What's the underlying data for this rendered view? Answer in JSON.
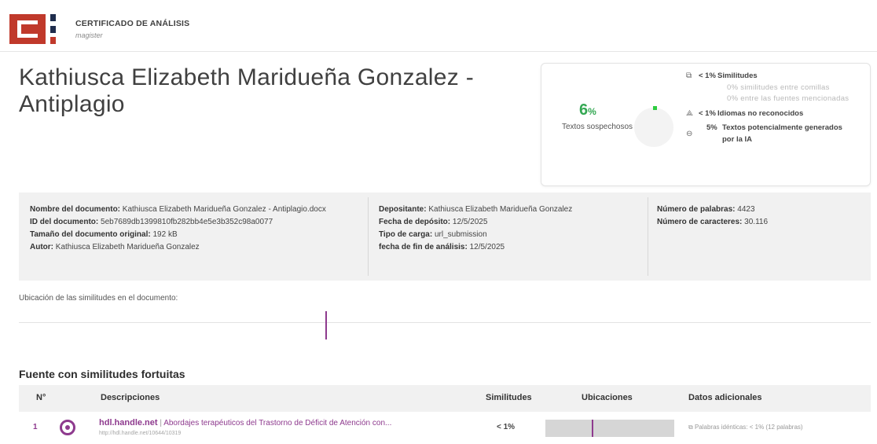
{
  "header": {
    "title": "CERTIFICADO DE ANÁLISIS",
    "subtitle": "magister"
  },
  "document": {
    "title": "Kathiusca Elizabeth Maridueña Gonzalez -Antiplagio"
  },
  "score": {
    "percent": "6",
    "percent_unit": "%",
    "label": "Textos sospechosos",
    "accent_color": "#34a853",
    "legend": [
      {
        "icon": "copy-icon",
        "value": "< 1%",
        "name": "Similitudes"
      },
      {
        "sub": "0% similitudes entre comillas"
      },
      {
        "sub": "0% entre las fuentes mencionadas"
      },
      {
        "icon": "translate-icon",
        "value": "< 1%",
        "name": "Idiomas no reconocidos"
      },
      {
        "icon": "ai-icon",
        "value": "5%",
        "name": "Textos potencialmente generados por la IA"
      }
    ]
  },
  "info": {
    "col1": [
      {
        "label": "Nombre del documento:",
        "value": "Kathiusca Elizabeth Maridueña Gonzalez - Antiplagio.docx"
      },
      {
        "label": "ID del documento:",
        "value": "5eb7689db1399810fb282bb4e5e3b352c98a0077"
      },
      {
        "label": "Tamaño del documento original:",
        "value": "192 kB"
      },
      {
        "label": "Autor:",
        "value": "Kathiusca Elizabeth Maridueña Gonzalez"
      }
    ],
    "col2": [
      {
        "label": "Depositante:",
        "value": "Kathiusca Elizabeth Maridueña Gonzalez"
      },
      {
        "label": "Fecha de depósito:",
        "value": "12/5/2025"
      },
      {
        "label": "Tipo de carga:",
        "value": "url_submission"
      },
      {
        "label": "fecha de fin de análisis:",
        "value": "12/5/2025"
      }
    ],
    "col3": [
      {
        "label": "Número de palabras:",
        "value": "4423"
      },
      {
        "label": "Número de caracteres:",
        "value": "30.116"
      }
    ]
  },
  "location": {
    "label": "Ubicación de las similitudes en el documento:",
    "marker_position_fraction": 0.36
  },
  "sources": {
    "section_title": "Fuente con similitudes fortuitas",
    "headers": [
      "N°",
      "Descripciones",
      "Similitudes",
      "Ubicaciones",
      "Datos adicionales"
    ],
    "rows": [
      {
        "num": "1",
        "domain": "hdl.handle.net",
        "separator": "|",
        "title": "Abordajes terapéuticos del Trastorno de Déficit de Atención con...",
        "url": "http://hdl.handle.net/10644/10319",
        "similarity": "< 1%",
        "location_fraction": 0.36,
        "additional": "Palabras idénticas: < 1% (12 palabras)"
      }
    ]
  }
}
